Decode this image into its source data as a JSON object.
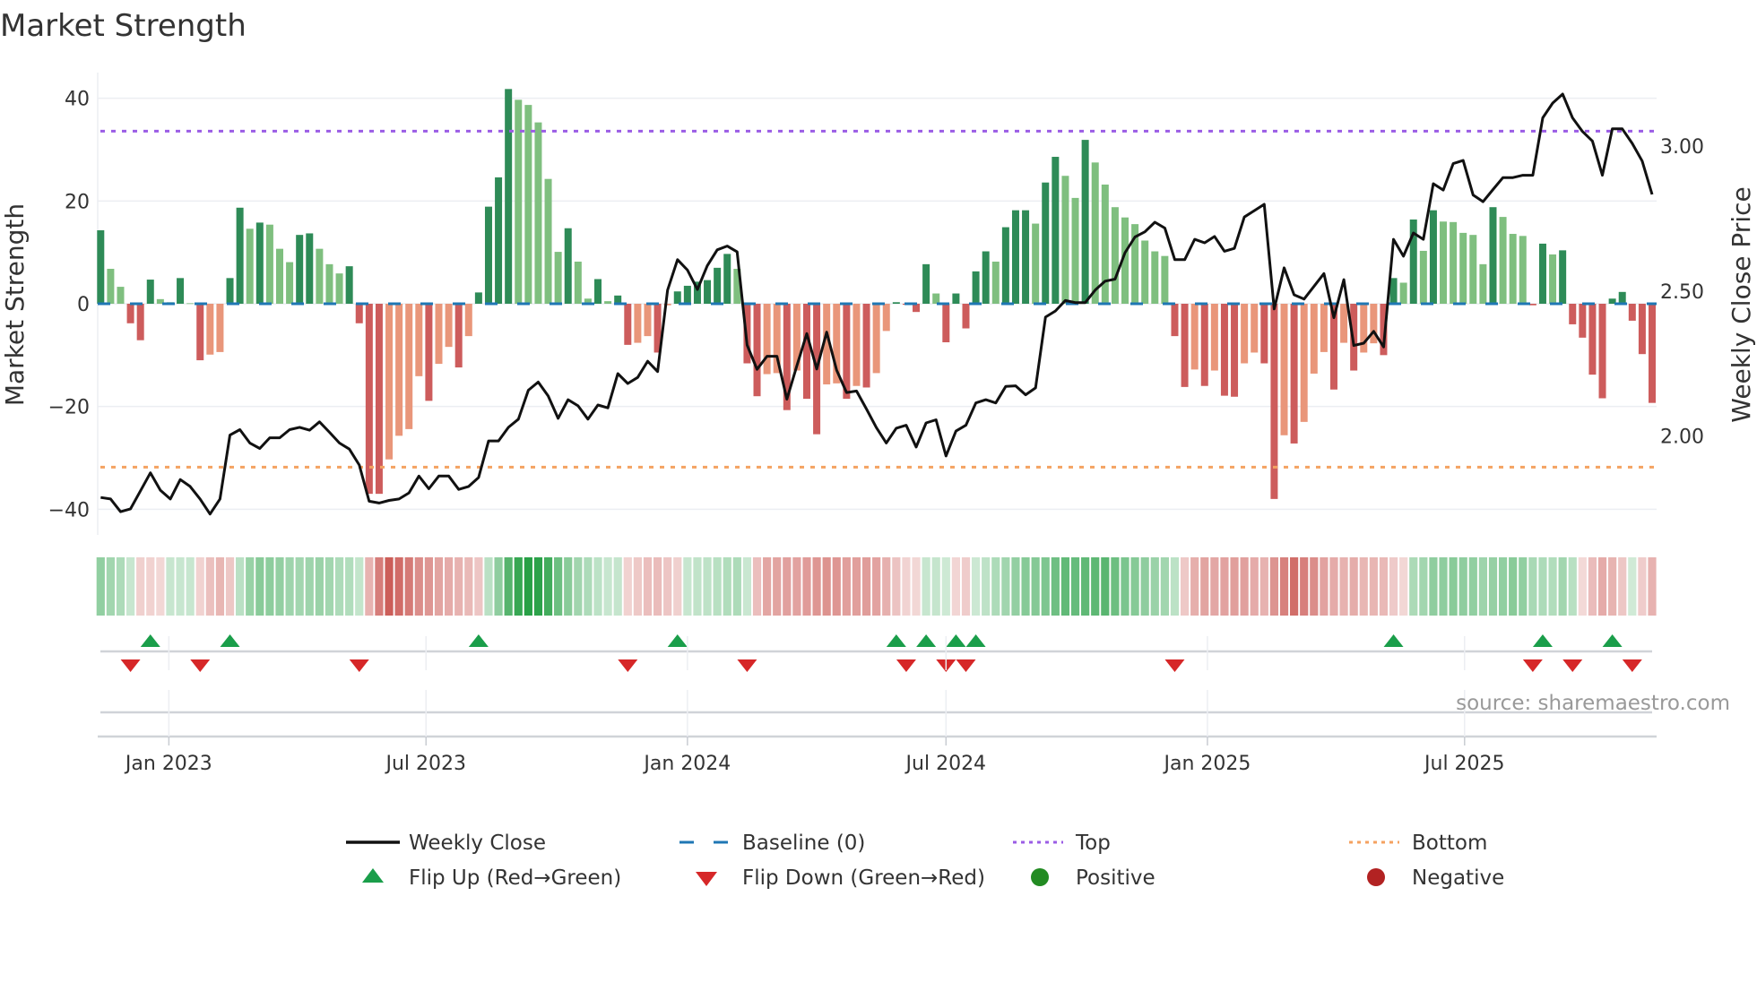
{
  "chart_data": {
    "type": "bar",
    "title": "Market Strength",
    "ylabel": "Market Strength",
    "y2label": "Weekly Close Price",
    "start_date": "2022-11-14",
    "frequency": "weekly",
    "ylim": [
      -45,
      45
    ],
    "y2lim": [
      1.659,
      3.253
    ],
    "yticks": [
      {
        "value": 40,
        "label": "40"
      },
      {
        "value": 20,
        "label": "20"
      },
      {
        "value": 0,
        "label": "0"
      },
      {
        "value": -20,
        "label": "−20"
      },
      {
        "value": -40,
        "label": "−40"
      }
    ],
    "y2ticks": [
      {
        "value": 3.0,
        "label": "3.00"
      },
      {
        "value": 2.5,
        "label": "2.50"
      },
      {
        "value": 2.0,
        "label": "2.00"
      }
    ],
    "xticks": [
      {
        "date": "2023-01-01",
        "label": "Jan 2023"
      },
      {
        "date": "2023-07-01",
        "label": "Jul 2023"
      },
      {
        "date": "2024-01-01",
        "label": "Jan 2024"
      },
      {
        "date": "2024-07-01",
        "label": "Jul 2024"
      },
      {
        "date": "2025-01-01",
        "label": "Jan 2025"
      },
      {
        "date": "2025-07-01",
        "label": "Jul 2025"
      }
    ],
    "top_level": 33.6,
    "bottom_level": -31.8,
    "baseline": 0,
    "strength": [
      14.3,
      6.8,
      3.3,
      -3.8,
      -7.1,
      4.7,
      0.9,
      0.3,
      5.0,
      0.1,
      -11.0,
      -9.9,
      -9.4,
      5.0,
      18.7,
      14.6,
      15.8,
      15.4,
      10.7,
      8.1,
      13.4,
      13.7,
      10.7,
      7.7,
      5.9,
      7.3,
      -3.8,
      -37.0,
      -37.0,
      -30.3,
      -25.7,
      -24.4,
      -14.1,
      -18.9,
      -11.7,
      -8.4,
      -12.4,
      -6.3,
      2.2,
      18.9,
      24.6,
      41.8,
      39.7,
      38.7,
      35.3,
      24.3,
      10.1,
      14.7,
      8.2,
      1.0,
      4.8,
      0.5,
      1.6,
      -8.0,
      -7.6,
      -6.3,
      -9.5,
      -0.3,
      2.4,
      3.5,
      4.3,
      4.6,
      7.0,
      9.7,
      6.8,
      -11.6,
      -18.0,
      -13.7,
      -13.5,
      -20.7,
      -13.0,
      -18.5,
      -25.4,
      -15.7,
      -15.5,
      -18.5,
      -16.0,
      -16.3,
      -13.5,
      -5.3,
      0.3,
      -0.2,
      -1.6,
      7.7,
      2.0,
      -7.5,
      2.0,
      -4.8,
      6.3,
      10.2,
      8.2,
      14.9,
      18.2,
      18.2,
      15.6,
      23.6,
      28.6,
      24.9,
      20.6,
      31.9,
      27.5,
      23.2,
      18.8,
      16.8,
      15.5,
      12.3,
      10.2,
      9.3,
      -6.3,
      -16.2,
      -12.8,
      -16.0,
      -13.0,
      -17.9,
      -18.1,
      -11.6,
      -9.5,
      -11.6,
      -38.0,
      -25.6,
      -27.2,
      -23.0,
      -13.6,
      -9.4,
      -16.7,
      -7.6,
      -13.0,
      -9.5,
      -7.7,
      -10.0,
      5.0,
      4.1,
      16.4,
      10.3,
      18.2,
      16.0,
      15.9,
      13.8,
      13.4,
      7.7,
      18.8,
      16.9,
      13.6,
      13.2,
      -0.3,
      11.7,
      9.6,
      10.4,
      -4.0,
      -6.6,
      -13.8,
      -18.4,
      1.0,
      2.3,
      -3.3,
      -9.8,
      -19.3
    ],
    "close": [
      1.788,
      1.783,
      1.739,
      1.749,
      1.811,
      1.873,
      1.813,
      1.783,
      1.85,
      1.826,
      1.783,
      1.731,
      1.783,
      2.003,
      2.022,
      1.976,
      1.957,
      1.994,
      1.994,
      2.022,
      2.03,
      2.02,
      2.049,
      2.013,
      1.976,
      1.955,
      1.9,
      1.775,
      1.769,
      1.778,
      1.783,
      1.804,
      1.862,
      1.818,
      1.862,
      1.862,
      1.816,
      1.826,
      1.857,
      1.983,
      1.983,
      2.03,
      2.058,
      2.158,
      2.186,
      2.138,
      2.061,
      2.125,
      2.104,
      2.058,
      2.107,
      2.097,
      2.215,
      2.181,
      2.202,
      2.258,
      2.222,
      2.503,
      2.608,
      2.572,
      2.505,
      2.587,
      2.642,
      2.655,
      2.635,
      2.314,
      2.23,
      2.275,
      2.275,
      2.127,
      2.242,
      2.353,
      2.231,
      2.358,
      2.227,
      2.15,
      2.155,
      2.093,
      2.029,
      1.976,
      2.027,
      2.037,
      1.962,
      2.045,
      2.056,
      1.931,
      2.017,
      2.037,
      2.114,
      2.125,
      2.114,
      2.171,
      2.173,
      2.142,
      2.166,
      2.41,
      2.431,
      2.467,
      2.46,
      2.46,
      2.503,
      2.534,
      2.541,
      2.632,
      2.686,
      2.704,
      2.737,
      2.717,
      2.608,
      2.608,
      2.678,
      2.666,
      2.688,
      2.637,
      2.647,
      2.755,
      2.777,
      2.799,
      2.438,
      2.58,
      2.487,
      2.472,
      2.516,
      2.56,
      2.408,
      2.539,
      2.312,
      2.32,
      2.361,
      2.307,
      2.678,
      2.62,
      2.7,
      2.678,
      2.87,
      2.848,
      2.939,
      2.95,
      2.831,
      2.808,
      2.85,
      2.891,
      2.891,
      2.899,
      2.899,
      3.097,
      3.148,
      3.179,
      3.097,
      3.05,
      3.017,
      2.899,
      3.059,
      3.059,
      3.009,
      2.948,
      2.833
    ],
    "colors": {
      "positive_rising": "#2e8b57",
      "positive_falling": "#7fbf7f",
      "negative_falling": "#cd5c5c",
      "negative_rising": "#e9967a",
      "close_line": "#111111",
      "baseline": "#1f77b4",
      "top": "#9b5de5",
      "bottom": "#f4a261",
      "flip_up": "#1a9e4a",
      "flip_down": "#d62728",
      "positive": "#228b22",
      "negative": "#b22222"
    },
    "legend": {
      "position": "bottom",
      "items": [
        {
          "key": "close",
          "label": "Weekly Close"
        },
        {
          "key": "baseline",
          "label": "Baseline (0)"
        },
        {
          "key": "top",
          "label": "Top"
        },
        {
          "key": "bottom",
          "label": "Bottom"
        },
        {
          "key": "flip_up",
          "label": "Flip Up (Red→Green)"
        },
        {
          "key": "flip_down",
          "label": "Flip Down (Green→Red)"
        },
        {
          "key": "positive",
          "label": "Positive"
        },
        {
          "key": "negative",
          "label": "Negative"
        }
      ]
    },
    "source": "source: sharemaestro.com"
  }
}
